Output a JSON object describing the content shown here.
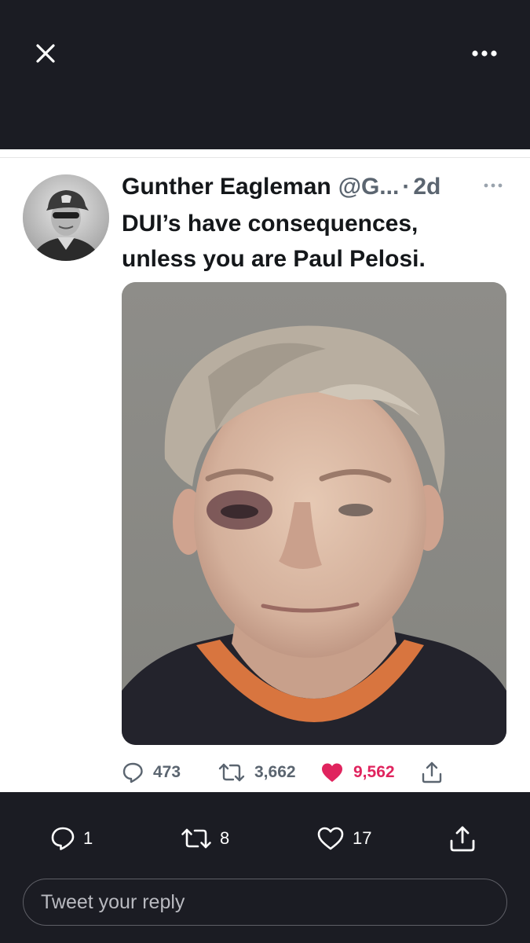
{
  "top_bar": {
    "close_icon": "close-icon",
    "more_icon": "more-horizontal-icon"
  },
  "tweet": {
    "author_name": "Gunther Eagleman",
    "author_handle": "@G...",
    "separator": "·",
    "time": "2d",
    "text_line1": "DUI’s have consequences,",
    "text_line2": "unless you are Paul Pelosi.",
    "avatar": "user-avatar-photo",
    "media": "mugshot-photo",
    "stats": {
      "replies": "473",
      "retweets": "3,662",
      "likes": "9,562"
    },
    "like_color": "#e0245e"
  },
  "bottom_bar": {
    "replies": "1",
    "retweets": "8",
    "likes": "17",
    "reply_placeholder": "Tweet your reply"
  }
}
